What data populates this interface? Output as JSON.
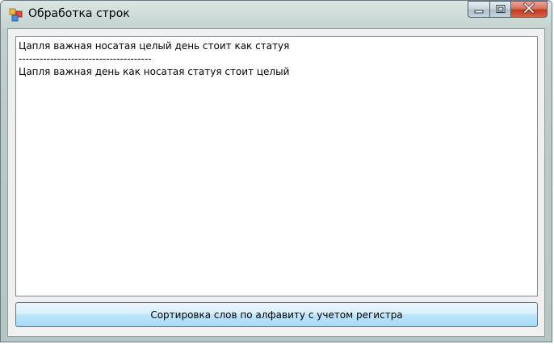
{
  "window": {
    "title": "Обработка строк",
    "icon": "app-form-icon",
    "caption": {
      "minimize_icon": "minimize-icon",
      "maximize_icon": "maximize-icon",
      "close_icon": "close-icon"
    }
  },
  "textbox": {
    "lines": [
      "Цапля важная носатая целый день стоит как статуя",
      "--------------------------------------",
      "Цапля важная день как носатая статуя стоит целый"
    ]
  },
  "sort_button": {
    "label": "Сортировка слов по алфавиту с учетом регистра"
  },
  "colors": {
    "close_button": "#c4391f",
    "button_border": "#3c7fb1",
    "textbox_border": "#828790"
  }
}
